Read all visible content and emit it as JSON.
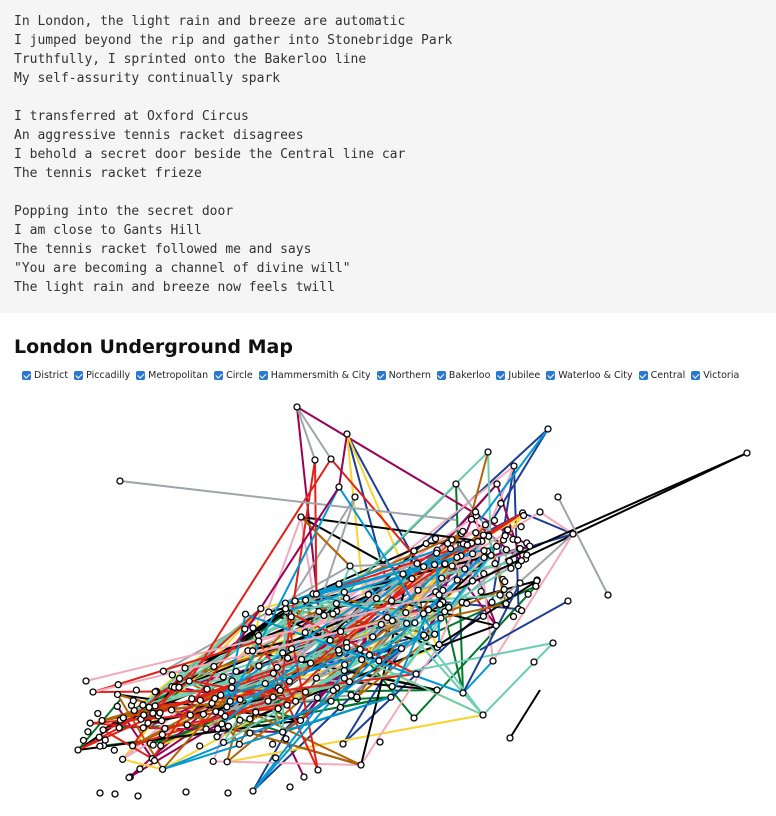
{
  "poem": {
    "stanzas": [
      [
        "In London, the light rain and breeze are automatic",
        "I jumped beyond the rip and gather into Stonebridge Park",
        "Truthfully, I sprinted onto the Bakerloo line",
        "My self-assurity continually spark"
      ],
      [
        "I transferred at Oxford Circus",
        "An aggressive tennis racket disagrees",
        "I behold a secret door beside the Central line car",
        "The tennis racket frieze"
      ],
      [
        "Popping into the secret door",
        "I am close to Gants Hill",
        "The tennis racket followed me and says",
        "\"You are becoming a channel of divine will\"",
        "The light rain and breeze now feels twill"
      ]
    ]
  },
  "map": {
    "title": "London Underground Map",
    "lines": [
      {
        "id": "district",
        "label": "District",
        "color": "#00782a",
        "checked": true
      },
      {
        "id": "piccadilly",
        "label": "Piccadilly",
        "color": "#1c3f94",
        "checked": true
      },
      {
        "id": "metropolitan",
        "label": "Metropolitan",
        "color": "#9b0058",
        "checked": true
      },
      {
        "id": "circle",
        "label": "Circle",
        "color": "#f8d42d",
        "checked": true
      },
      {
        "id": "hammersmith",
        "label": "Hammersmith & City",
        "color": "#f3a9bb",
        "checked": true
      },
      {
        "id": "northern",
        "label": "Northern",
        "color": "#000000",
        "checked": true
      },
      {
        "id": "bakerloo",
        "label": "Bakerloo",
        "color": "#b36305",
        "checked": true
      },
      {
        "id": "jubilee",
        "label": "Jubilee",
        "color": "#a0a5a9",
        "checked": true
      },
      {
        "id": "waterloo",
        "label": "Waterloo & City",
        "color": "#6bcdb2",
        "checked": true
      },
      {
        "id": "central",
        "label": "Central",
        "color": "#e32017",
        "checked": true
      },
      {
        "id": "victoria",
        "label": "Victoria",
        "color": "#0098d4",
        "checked": true
      }
    ]
  }
}
